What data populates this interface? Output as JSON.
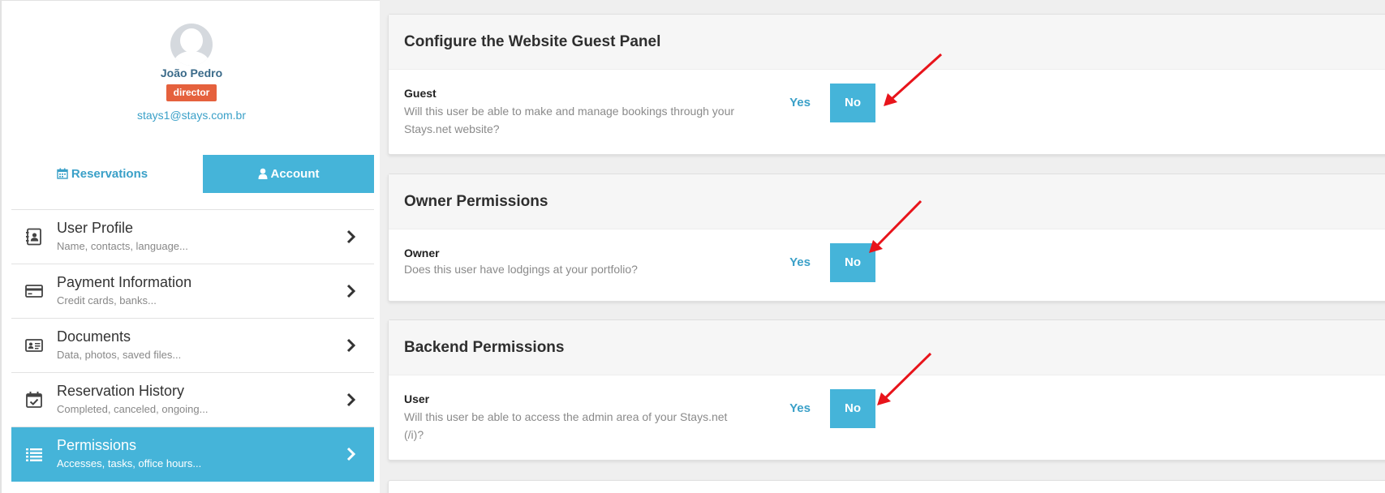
{
  "profile": {
    "name": "João Pedro",
    "role": "director",
    "email": "stays1@stays.com.br"
  },
  "tabs": [
    {
      "label": "Reservations",
      "icon": "calendar-icon",
      "active": false
    },
    {
      "label": "Account",
      "icon": "user-icon",
      "active": true
    }
  ],
  "menu": [
    {
      "title": "User Profile",
      "subtitle": "Name, contacts, language...",
      "icon": "contact-book-icon",
      "active": false
    },
    {
      "title": "Payment Information",
      "subtitle": "Credit cards, banks...",
      "icon": "credit-card-icon",
      "active": false
    },
    {
      "title": "Documents",
      "subtitle": "Data, photos, saved files...",
      "icon": "id-card-icon",
      "active": false
    },
    {
      "title": "Reservation History",
      "subtitle": "Completed, canceled, ongoing...",
      "icon": "calendar-check-icon",
      "active": false
    },
    {
      "title": "Permissions",
      "subtitle": "Accesses, tasks, office hours...",
      "icon": "list-icon",
      "active": true
    }
  ],
  "sections": [
    {
      "title": "Configure the Website Guest Panel",
      "field_label": "Guest",
      "field_description": "Will this user be able to make and manage bookings through your Stays.net website?",
      "yes_label": "Yes",
      "no_label": "No",
      "selected": "No"
    },
    {
      "title": "Owner Permissions",
      "field_label": "Owner",
      "field_description": "Does this user have lodgings at your portfolio?",
      "yes_label": "Yes",
      "no_label": "No",
      "selected": "No"
    },
    {
      "title": "Backend Permissions",
      "field_label": "User",
      "field_description": "Will this user be able to access the admin area of your Stays.net (/i)?",
      "yes_label": "Yes",
      "no_label": "No",
      "selected": "No"
    }
  ],
  "colors": {
    "accent": "#45b4d9",
    "link": "#3aa0c8",
    "badge": "#e5613d",
    "annotation_arrow": "#e8141b"
  }
}
